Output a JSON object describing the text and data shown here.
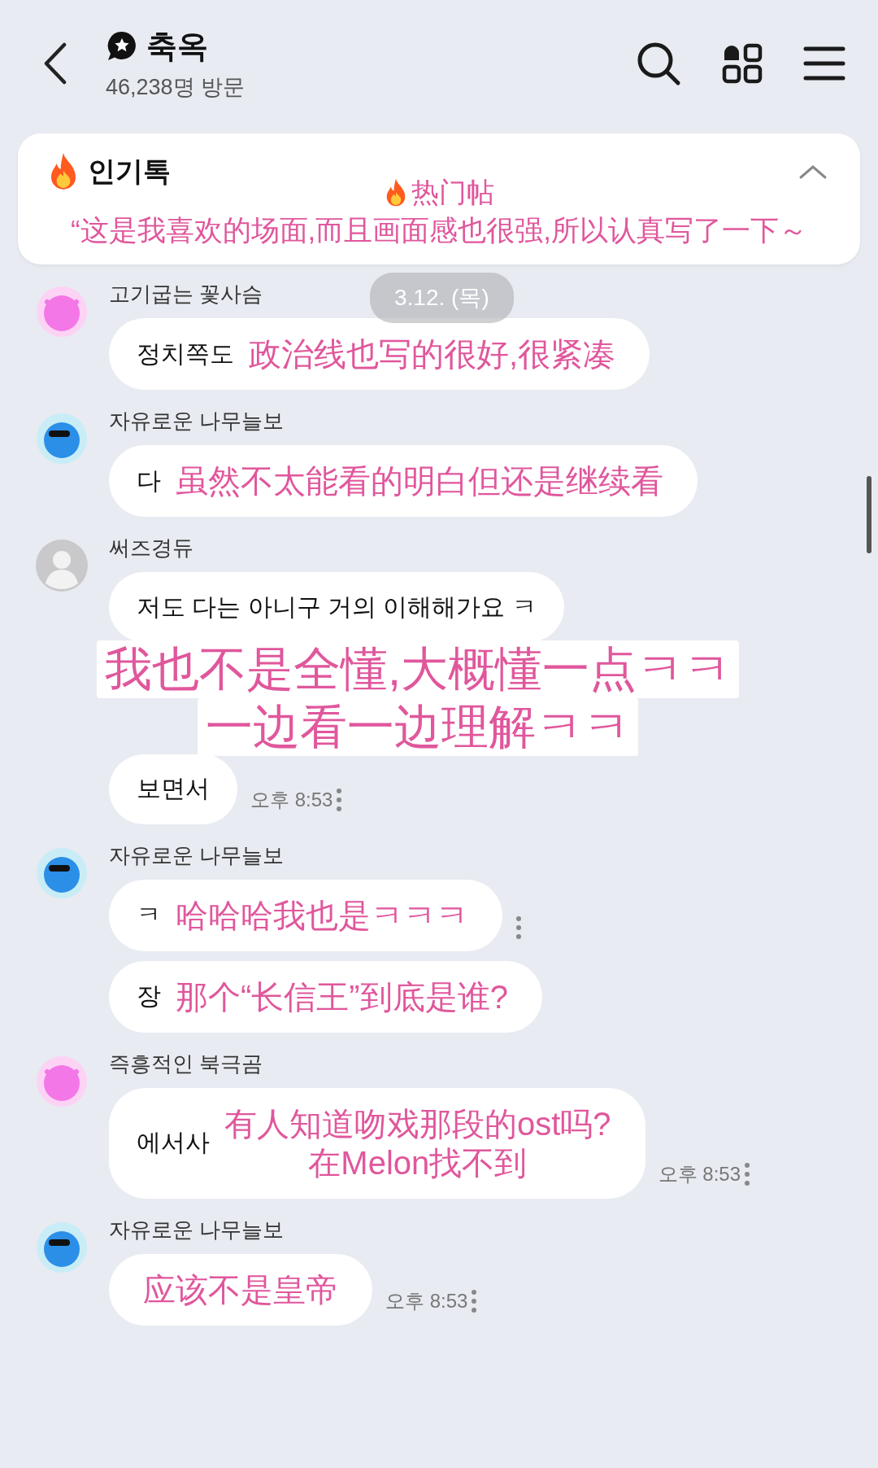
{
  "header": {
    "title": "축옥",
    "visitors": "46,238명 방문"
  },
  "popular": {
    "label": "인기톡",
    "expanded": true,
    "caption": "热门帖",
    "quote": "“这是我喜欢的场面,而且画面感也很强,所以认真写了一下～"
  },
  "date_chip": "3.12. (목)",
  "messages": [
    {
      "author": "고기굽는 꽃사슴",
      "kind": "cat",
      "bubbles": [
        {
          "text": "정치쪽도",
          "caption": [
            "政治线也写的很好,很紧凑"
          ]
        }
      ]
    },
    {
      "author": "자유로운 나무늘보",
      "kind": "shades",
      "bubbles": [
        {
          "text": "다",
          "caption": [
            "虽然不太能看的明白但还是继续看"
          ]
        }
      ]
    },
    {
      "author": "써즈경듀",
      "kind": "blank",
      "bubbles": [
        {
          "text": "저도 다는 아니구 거의 이해해가요 ㅋ"
        },
        {
          "text": "보면서",
          "time": "오후 8:53"
        }
      ],
      "caption": [
        "我也不是全懂,大概懂一点ㅋㅋ",
        "一边看一边理解ㅋㅋ"
      ]
    },
    {
      "author": "자유로운 나무늘보",
      "kind": "shades",
      "bubbles": [
        {
          "text": "ㅋ",
          "caption": [
            "哈哈哈我也是ㅋㅋㅋ"
          ],
          "more": true
        },
        {
          "text": "장",
          "caption": [
            "那个“长信王”到底是谁?"
          ]
        }
      ]
    },
    {
      "author": "즉흥적인 북극곰",
      "kind": "cat",
      "bubbles": [
        {
          "text": "에서사",
          "caption": [
            "有人知道吻戏那段的ost吗?",
            "在Melon找不到"
          ],
          "time": "오후 8:53"
        }
      ]
    },
    {
      "author": "자유로운 나무늘보",
      "kind": "shades",
      "bubbles": [
        {
          "caption": [
            "应该不是皇帝"
          ],
          "time": "오후 8:53"
        }
      ]
    }
  ]
}
